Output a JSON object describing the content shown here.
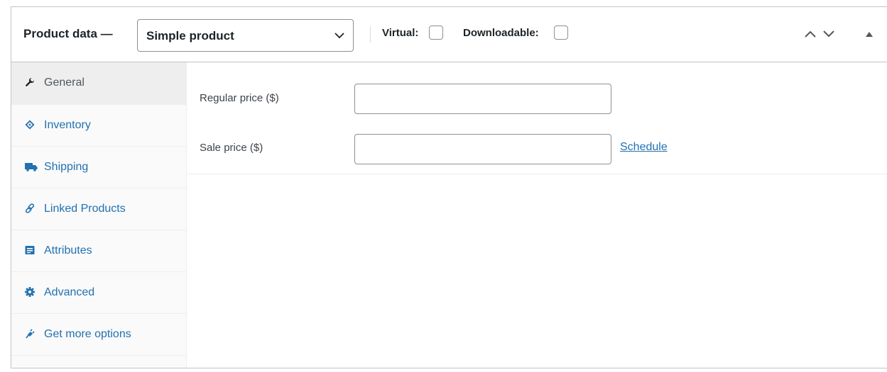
{
  "header": {
    "title": "Product data —",
    "product_type": {
      "selected": "Simple product"
    },
    "virtual_label": "Virtual:",
    "downloadable_label": "Downloadable:",
    "icons": [
      "chevron-up-icon",
      "chevron-down-icon",
      "toggle-arrow-up-icon"
    ]
  },
  "sidebar": {
    "items": [
      {
        "label": "General",
        "icon": "wrench-icon"
      },
      {
        "label": "Inventory",
        "icon": "tag-icon"
      },
      {
        "label": "Shipping",
        "icon": "truck-icon"
      },
      {
        "label": "Linked Products",
        "icon": "link-icon"
      },
      {
        "label": "Attributes",
        "icon": "list-card-icon"
      },
      {
        "label": "Advanced",
        "icon": "gear-icon"
      },
      {
        "label": "Get more options",
        "icon": "plugin-icon"
      }
    ],
    "active_index": 0
  },
  "general": {
    "regular_price_label": "Regular price ($)",
    "regular_price_value": "",
    "sale_price_label": "Sale price ($)",
    "sale_price_value": "",
    "schedule_link": "Schedule"
  },
  "colors": {
    "link": "#2271b1",
    "active_tab_bg": "#eeeeee",
    "border": "#c3c4c7"
  }
}
